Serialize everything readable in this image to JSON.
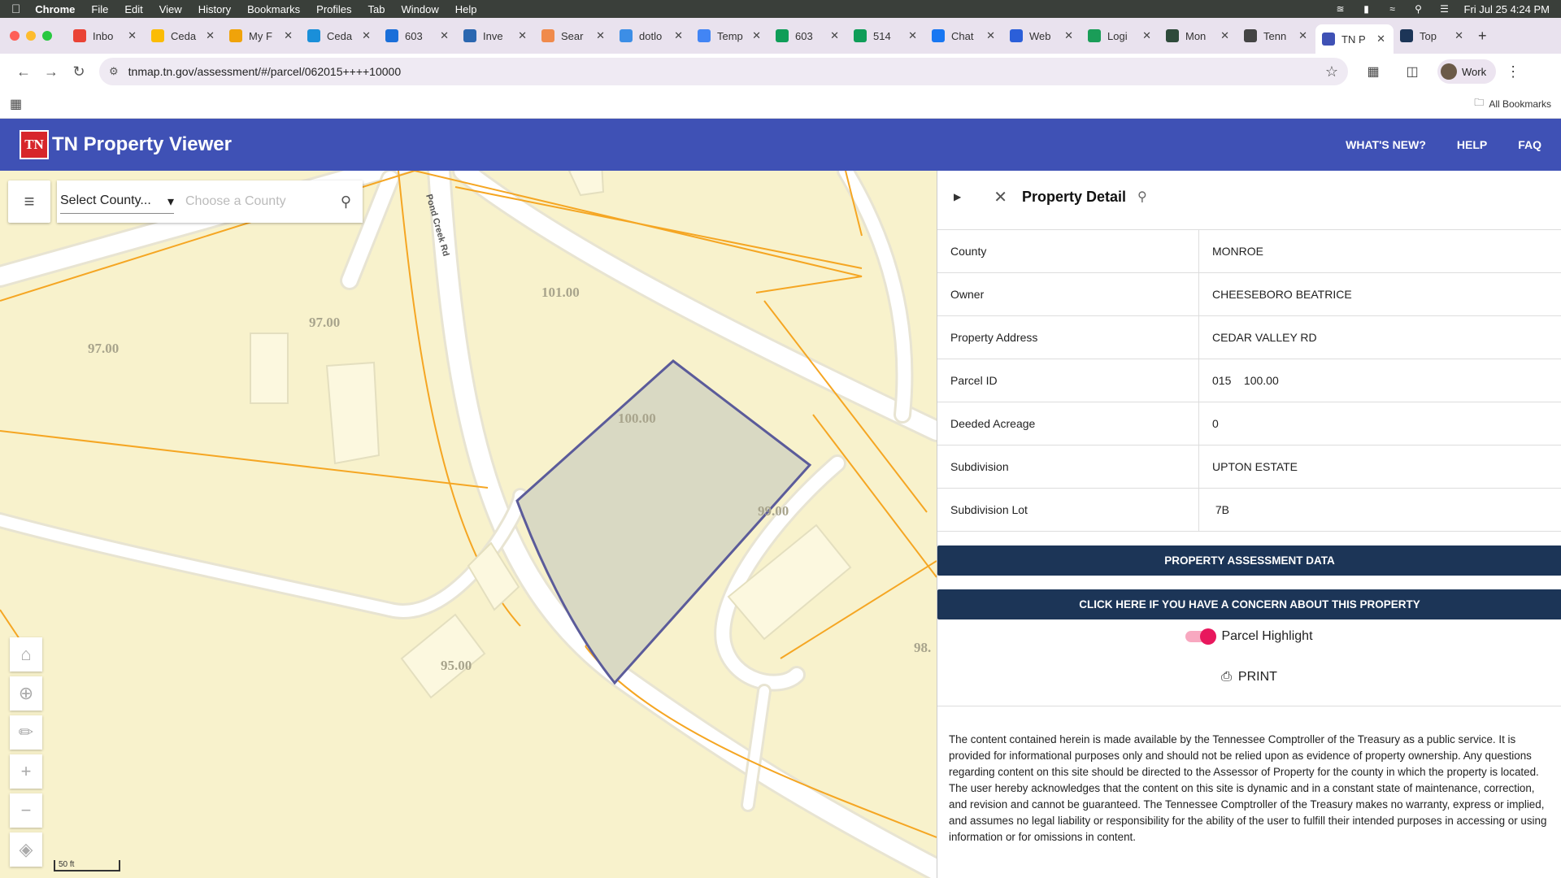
{
  "menubar": {
    "items": [
      "Chrome",
      "File",
      "Edit",
      "View",
      "History",
      "Bookmarks",
      "Profiles",
      "Tab",
      "Window",
      "Help"
    ],
    "clock": "Fri Jul 25  4:24 PM"
  },
  "tabs": [
    {
      "label": "Inbo",
      "color": "#ea4335"
    },
    {
      "label": "Ceda",
      "color": "#fbbc04"
    },
    {
      "label": "My F",
      "color": "#f0a30a"
    },
    {
      "label": "Ceda",
      "color": "#1a8fd9"
    },
    {
      "label": "603",
      "color": "#1a6fd9"
    },
    {
      "label": "Inve",
      "color": "#2b67b0"
    },
    {
      "label": "Sear",
      "color": "#f08a4b"
    },
    {
      "label": "dotlo",
      "color": "#3c8ee6"
    },
    {
      "label": "Temp",
      "color": "#4285f4"
    },
    {
      "label": "603",
      "color": "#0f9d58"
    },
    {
      "label": "514",
      "color": "#0f9d58"
    },
    {
      "label": "Chat",
      "color": "#1877f2"
    },
    {
      "label": "Web",
      "color": "#2b5fd9"
    },
    {
      "label": "Logi",
      "color": "#1a9d58"
    },
    {
      "label": "Mon",
      "color": "#2e4a3a"
    },
    {
      "label": "Tenn",
      "color": "#444444"
    },
    {
      "label": "TN P",
      "color": "#3f51b5",
      "active": true
    },
    {
      "label": "Top",
      "color": "#1c3557"
    }
  ],
  "browser": {
    "url": "tnmap.tn.gov/assessment/#/parcel/062015++++10000",
    "profile": "Work",
    "bookmarks_all": "All Bookmarks"
  },
  "app": {
    "logo": "TN",
    "title": "TN Property Viewer",
    "nav": [
      "WHAT'S NEW?",
      "HELP",
      "FAQ"
    ]
  },
  "search": {
    "county_select": "Select County...",
    "county_placeholder": "Choose a County"
  },
  "map": {
    "road_label": "Pond Creek Rd",
    "parcel_labels": [
      "101.00",
      "97.00",
      "97.00",
      "100.00",
      "99.00",
      "95.00",
      "98."
    ],
    "scale": "50 ft"
  },
  "detail": {
    "title": "Property Detail",
    "rows": [
      {
        "label": "County",
        "value": "MONROE"
      },
      {
        "label": "Owner",
        "value": "CHEESEBORO BEATRICE"
      },
      {
        "label": "Property Address",
        "value": "CEDAR VALLEY RD"
      },
      {
        "label": "Parcel ID",
        "value": "015    100.00"
      },
      {
        "label": "Deeded Acreage",
        "value": "0"
      },
      {
        "label": "Subdivision",
        "value": "UPTON ESTATE"
      },
      {
        "label": "Subdivision Lot",
        "value": " 7B"
      }
    ],
    "assessment_button": "PROPERTY ASSESSMENT DATA",
    "concern_button": "CLICK HERE IF YOU HAVE A CONCERN ABOUT THIS PROPERTY",
    "highlight_label": "Parcel Highlight",
    "print_label": "PRINT",
    "disclaimer": "The content contained herein is made available by the Tennessee Comptroller of the Treasury as a public service. It is provided for informational purposes only and should not be relied upon as evidence of property ownership. Any questions regarding content on this site should be directed to the Assessor of Property for the county in which the property is located. The user hereby acknowledges that the content on this site is dynamic and in a constant state of maintenance, correction, and revision and cannot be guaranteed. The Tennessee Comptroller of the Treasury makes no warranty, express or implied, and assumes no legal liability or responsibility for the ability of the user to fulfill their intended purposes in accessing or using information or for omissions in content."
  }
}
